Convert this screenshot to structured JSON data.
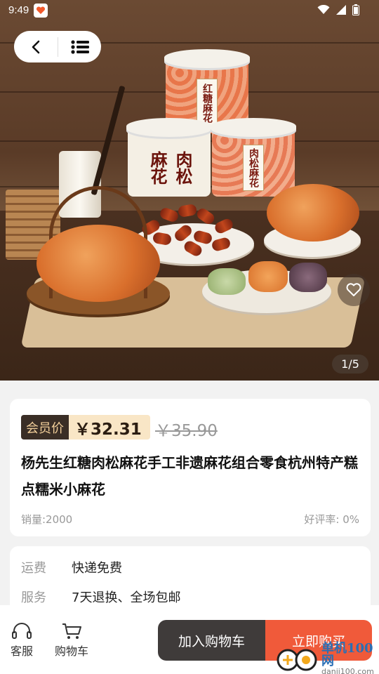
{
  "status_bar": {
    "time": "9:49"
  },
  "gallery": {
    "counter": "1/5"
  },
  "product_image": {
    "can1_label": "红糖麻花",
    "can2_label": "肉松麻花",
    "can3_label": "肉松麻花"
  },
  "product": {
    "member_label": "会员价",
    "member_price": "￥32.31",
    "original_price": "￥35.90",
    "title": "杨先生红糖肉松麻花手工非遗麻花组合零食杭州特产糕点糯米小麻花",
    "sales": "销量:2000",
    "rating": "好评率: 0%"
  },
  "info": {
    "shipping_key": "运费",
    "shipping_val": "快递免费",
    "service_key": "服务",
    "service_val": "7天退换、全场包邮"
  },
  "bottom_bar": {
    "service_label": "客服",
    "cart_label": "购物车",
    "add_to_cart": "加入购物车",
    "buy_now": "立即购买"
  },
  "watermark": {
    "cn": "单机100网",
    "en": "danji100.com"
  },
  "colors": {
    "buy": "#f05a3a",
    "cart_btn": "#3f3b3a",
    "member_tag_bg": "#3a2e26",
    "member_price_bg": "#f9e6c6"
  },
  "icons": [
    "back-icon",
    "menu-list-icon",
    "heart-icon",
    "headset-icon",
    "cart-icon",
    "wifi-icon",
    "signal-icon",
    "battery-icon"
  ]
}
